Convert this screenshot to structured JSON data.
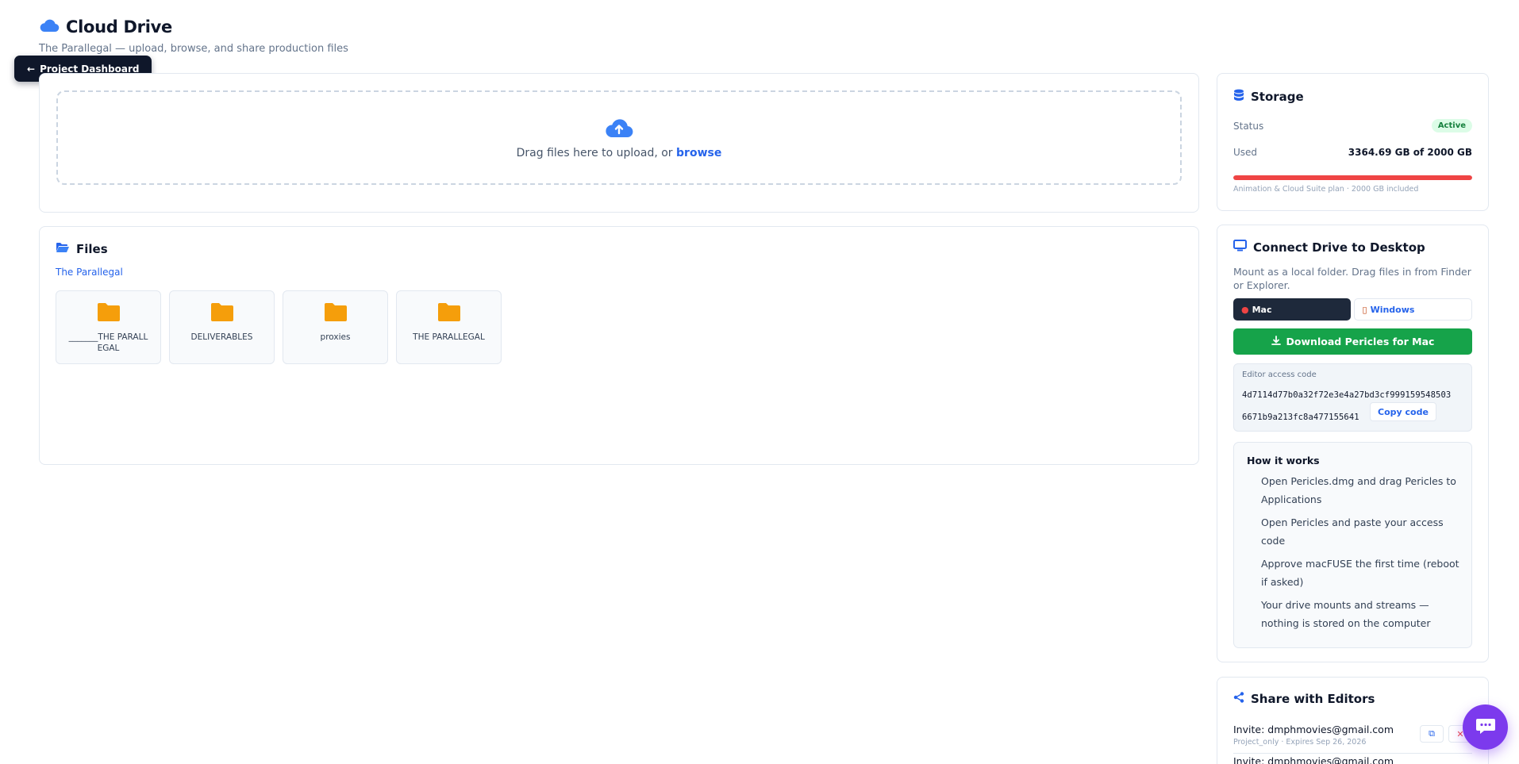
{
  "header": {
    "title": "Cloud Drive",
    "subtitle": "The Parallegal — upload, browse, and share production files",
    "dashboard_button": "Project Dashboard"
  },
  "upload": {
    "drop_text": "Drag files here to upload, or",
    "browse_label": "browse"
  },
  "files": {
    "heading": "Files",
    "breadcrumb": "The Parallegal",
    "folders": [
      {
        "name": "_______THE PARALLEGAL"
      },
      {
        "name": "DELIVERABLES"
      },
      {
        "name": "proxies"
      },
      {
        "name": "THE PARALLEGAL"
      }
    ]
  },
  "storage": {
    "heading": "Storage",
    "status_label": "Status",
    "status_value": "Active",
    "used_label": "Used",
    "used_value": "3364.69 GB of 2000 GB",
    "used_fraction": 1.0,
    "plan_note": "Animation & Cloud Suite plan · 2000 GB included"
  },
  "connect": {
    "heading": "Connect Drive to Desktop",
    "description": "Mount as a local folder. Drag files in from Finder or Explorer.",
    "tabs": [
      {
        "label": "Mac",
        "icon": "apple-icon",
        "active": true
      },
      {
        "label": "Windows",
        "icon": "windows-icon",
        "active": false
      }
    ],
    "download_label": "Download Pericles for Mac",
    "access_label": "Editor access code",
    "access_code": "4d7114d77b0a32f72e3e4a27bd3cf999159548503 6671b9a213fc8a477155641",
    "copy_label": "Copy code",
    "how_title": "How it works",
    "steps": [
      "Open Pericles.dmg and drag Pericles to Applications",
      "Open Pericles and paste your access code",
      "Approve macFUSE the first time (reboot if asked)",
      "Your drive mounts and streams — nothing is stored on the computer"
    ]
  },
  "share": {
    "heading": "Share with Editors",
    "invites": [
      {
        "email": "Invite: dmphmovies@gmail.com",
        "meta": "Project_only · Expires Sep 26, 2026"
      },
      {
        "email": "Invite: dmphmovies@gmail.com",
        "meta": ""
      }
    ]
  },
  "colors": {
    "accent": "#2563eb",
    "dark": "#0f172a",
    "success": "#16a34a",
    "danger": "#ef4444",
    "folder": "#f59e0b",
    "chat": "#7c3aed"
  }
}
